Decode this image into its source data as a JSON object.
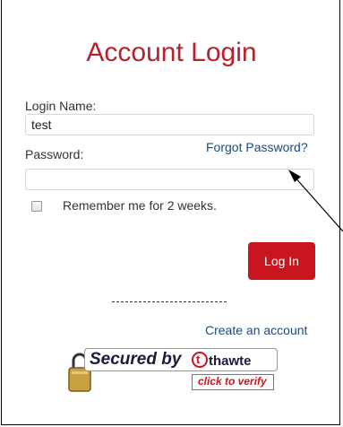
{
  "form": {
    "title": "Account Login",
    "login_name_label": "Login Name:",
    "login_name_value": "test",
    "password_label": "Password:",
    "password_value": "",
    "forgot_password_link": "Forgot Password?",
    "remember_me_label": "Remember me for 2 weeks.",
    "remember_me_checked": false,
    "login_button": "Log In",
    "separator": "--------------------",
    "create_account_link": "Create an account"
  },
  "seal": {
    "icon": "padlock-icon",
    "brand_mark": "thawte-logo",
    "lettering": [
      "Secured by",
      "thawte",
      "click to verify"
    ],
    "verify_label": "click to verify"
  },
  "colors": {
    "accent": "#c8151f",
    "title": "#b8202e",
    "link": "#1f4a7a"
  }
}
